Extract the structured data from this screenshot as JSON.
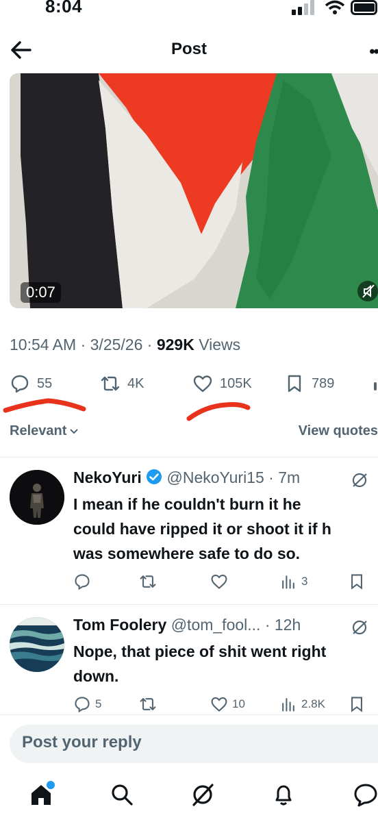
{
  "status_bar": {
    "time": "8:04"
  },
  "header": {
    "title": "Post",
    "back_icon": "arrow-left-icon",
    "more_icon": "ellipsis-icon"
  },
  "media": {
    "duration": "0:07",
    "mute_icon": "volume-off-icon"
  },
  "tweet_meta": {
    "time": "10:54 AM",
    "date": "3/25/26",
    "views_count": "929K",
    "views_label": "Views"
  },
  "stats": {
    "replies": "55",
    "reposts": "4K",
    "likes": "105K",
    "bookmarks": "789"
  },
  "sort": {
    "label": "Relevant",
    "view_quotes": "View quotes"
  },
  "replies": [
    {
      "name": "NekoYuri",
      "handle": "@NekoYuri15",
      "time": "7m",
      "verified": true,
      "text_lines": [
        "I mean if he couldn't burn it he",
        "could have ripped it or shoot it if h",
        "was somewhere safe to do so."
      ],
      "counts": {
        "replies": "",
        "reposts": "",
        "likes": "",
        "views": "3"
      }
    },
    {
      "name": "Tom Foolery",
      "handle": "@tom_fool...",
      "time": "12h",
      "verified": false,
      "text_lines": [
        "Nope, that piece of shit went right",
        "down."
      ],
      "counts": {
        "replies": "5",
        "reposts": "",
        "likes": "10",
        "views": "2.8K"
      }
    }
  ],
  "reply_box": {
    "placeholder": "Post your reply"
  },
  "colors": {
    "accent": "#1d9bf0",
    "annotation": "#e8321c",
    "muted": "#536471"
  }
}
